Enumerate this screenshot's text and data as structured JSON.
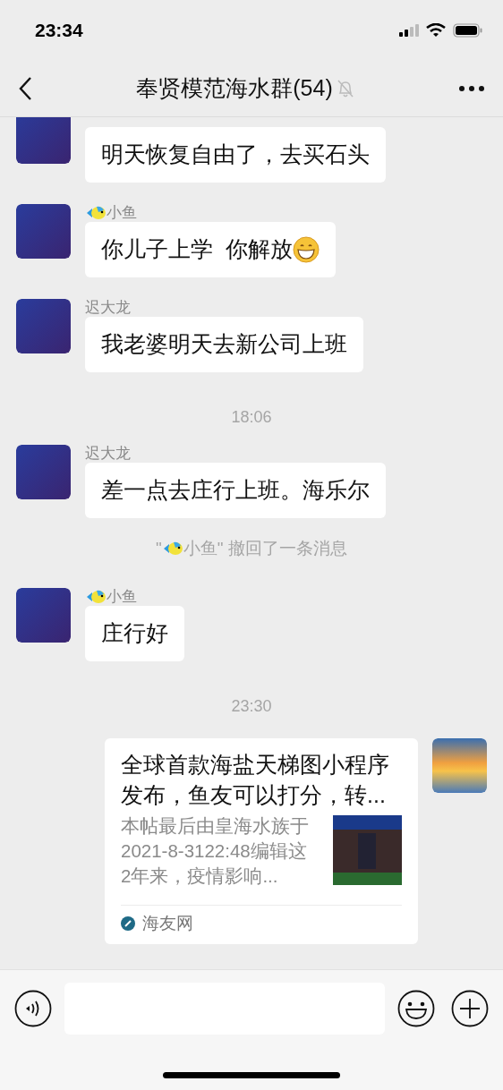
{
  "status_bar": {
    "time": "23:34"
  },
  "header": {
    "title": "奉贤模范海水群(54)",
    "muted": true
  },
  "messages": [
    {
      "kind": "text",
      "text": "明天恢复自由了，去买石头"
    },
    {
      "kind": "text",
      "name": "小鱼",
      "name_emoji": true,
      "text": "你儿子上学  你解放",
      "trailing_emoji": true
    },
    {
      "kind": "text",
      "name": "迟大龙",
      "text": "我老婆明天去新公司上班"
    },
    {
      "kind": "time",
      "text": "18:06"
    },
    {
      "kind": "text",
      "name": "迟大龙",
      "text": "差一点去庄行上班。海乐尔"
    },
    {
      "kind": "recall",
      "before": "\"",
      "name_emoji": true,
      "after": "小鱼\" 撤回了一条消息"
    },
    {
      "kind": "text",
      "name": "小鱼",
      "name_emoji": true,
      "text": "庄行好"
    },
    {
      "kind": "time",
      "text": "23:30"
    },
    {
      "kind": "link",
      "title": "全球首款海盐天梯图小程序发布，鱼友可以打分，转...",
      "description": "本帖最后由皇海水族于2021-8-3122:48编辑这2年来，疫情影响...",
      "source": "海友网"
    }
  ]
}
